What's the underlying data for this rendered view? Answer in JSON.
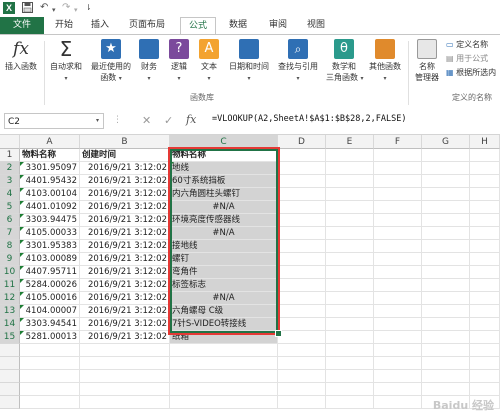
{
  "titlebar": {
    "app_icon": "X",
    "save_icon": "save-icon",
    "undo_icon": "undo-icon",
    "redo_icon": "redo-icon"
  },
  "tabs": [
    {
      "label": "文件",
      "type": "file"
    },
    {
      "label": "开始"
    },
    {
      "label": "插入"
    },
    {
      "label": "页面布局"
    },
    {
      "label": "公式",
      "active": true
    },
    {
      "label": "数据"
    },
    {
      "label": "审阅"
    },
    {
      "label": "视图"
    }
  ],
  "ribbon": {
    "insert_function": "插入函数",
    "autosum": "自动求和",
    "recent_line1": "最近使用的",
    "recent_line2": "函数",
    "finance": "财务",
    "logic": "逻辑",
    "text": "文本",
    "datetime": "日期和时间",
    "lookup": "查找与引用",
    "math_line1": "数学和",
    "math_line2": "三角函数",
    "other": "其他函数",
    "name_mgr_line1": "名称",
    "name_mgr_line2": "管理器",
    "define_name": "定义名称",
    "use_in_formula": "用于公式",
    "create_from_sel": "根据所选内",
    "group_library": "函数库",
    "group_names": "定义的名称"
  },
  "formula_bar": {
    "name_box": "C2",
    "fx": "fx",
    "formula": "=VLOOKUP(A2,SheetA!$A$1:$B$28,2,FALSE)"
  },
  "grid": {
    "columns": [
      "A",
      "B",
      "C",
      "D",
      "E",
      "F",
      "G",
      "H"
    ],
    "header_row": {
      "a": "物料名称",
      "b": "创建时间",
      "c": "物料名称"
    },
    "rows": [
      {
        "n": "2",
        "a": "3301.95097",
        "b": "2016/9/21 3:12:02",
        "c": "地线"
      },
      {
        "n": "3",
        "a": "4401.95432",
        "b": "2016/9/21 3:12:02",
        "c": "60寸系统挡板"
      },
      {
        "n": "4",
        "a": "4103.00104",
        "b": "2016/9/21 3:12:02",
        "c": "内六角圆柱头螺钉"
      },
      {
        "n": "5",
        "a": "4401.01092",
        "b": "2016/9/21 3:12:02",
        "c": "#N/A"
      },
      {
        "n": "6",
        "a": "3303.94475",
        "b": "2016/9/21 3:12:02",
        "c": "环境亮度传感器线"
      },
      {
        "n": "7",
        "a": "4105.00033",
        "b": "2016/9/21 3:12:02",
        "c": "#N/A"
      },
      {
        "n": "8",
        "a": "3301.95383",
        "b": "2016/9/21 3:12:02",
        "c": "接地线"
      },
      {
        "n": "9",
        "a": "4103.00089",
        "b": "2016/9/21 3:12:02",
        "c": "螺钉"
      },
      {
        "n": "10",
        "a": "4407.95711",
        "b": "2016/9/21 3:12:02",
        "c": "弯角件"
      },
      {
        "n": "11",
        "a": "5284.00026",
        "b": "2016/9/21 3:12:02",
        "c": "标签标志"
      },
      {
        "n": "12",
        "a": "4105.00016",
        "b": "2016/9/21 3:12:02",
        "c": "#N/A"
      },
      {
        "n": "13",
        "a": "4104.00007",
        "b": "2016/9/21 3:12:02",
        "c": "六角螺母 C级"
      },
      {
        "n": "14",
        "a": "3303.94541",
        "b": "2016/9/21 3:12:02",
        "c": "7针S-VIDEO转接线"
      },
      {
        "n": "15",
        "a": "5281.00013",
        "b": "2016/9/21 3:12:02",
        "c": "纸箱"
      }
    ]
  },
  "watermark": "Baidu 经验",
  "colors": {
    "accent": "#217346",
    "highlight_box": "#e53935",
    "selected_fill": "#d3d3d3"
  }
}
